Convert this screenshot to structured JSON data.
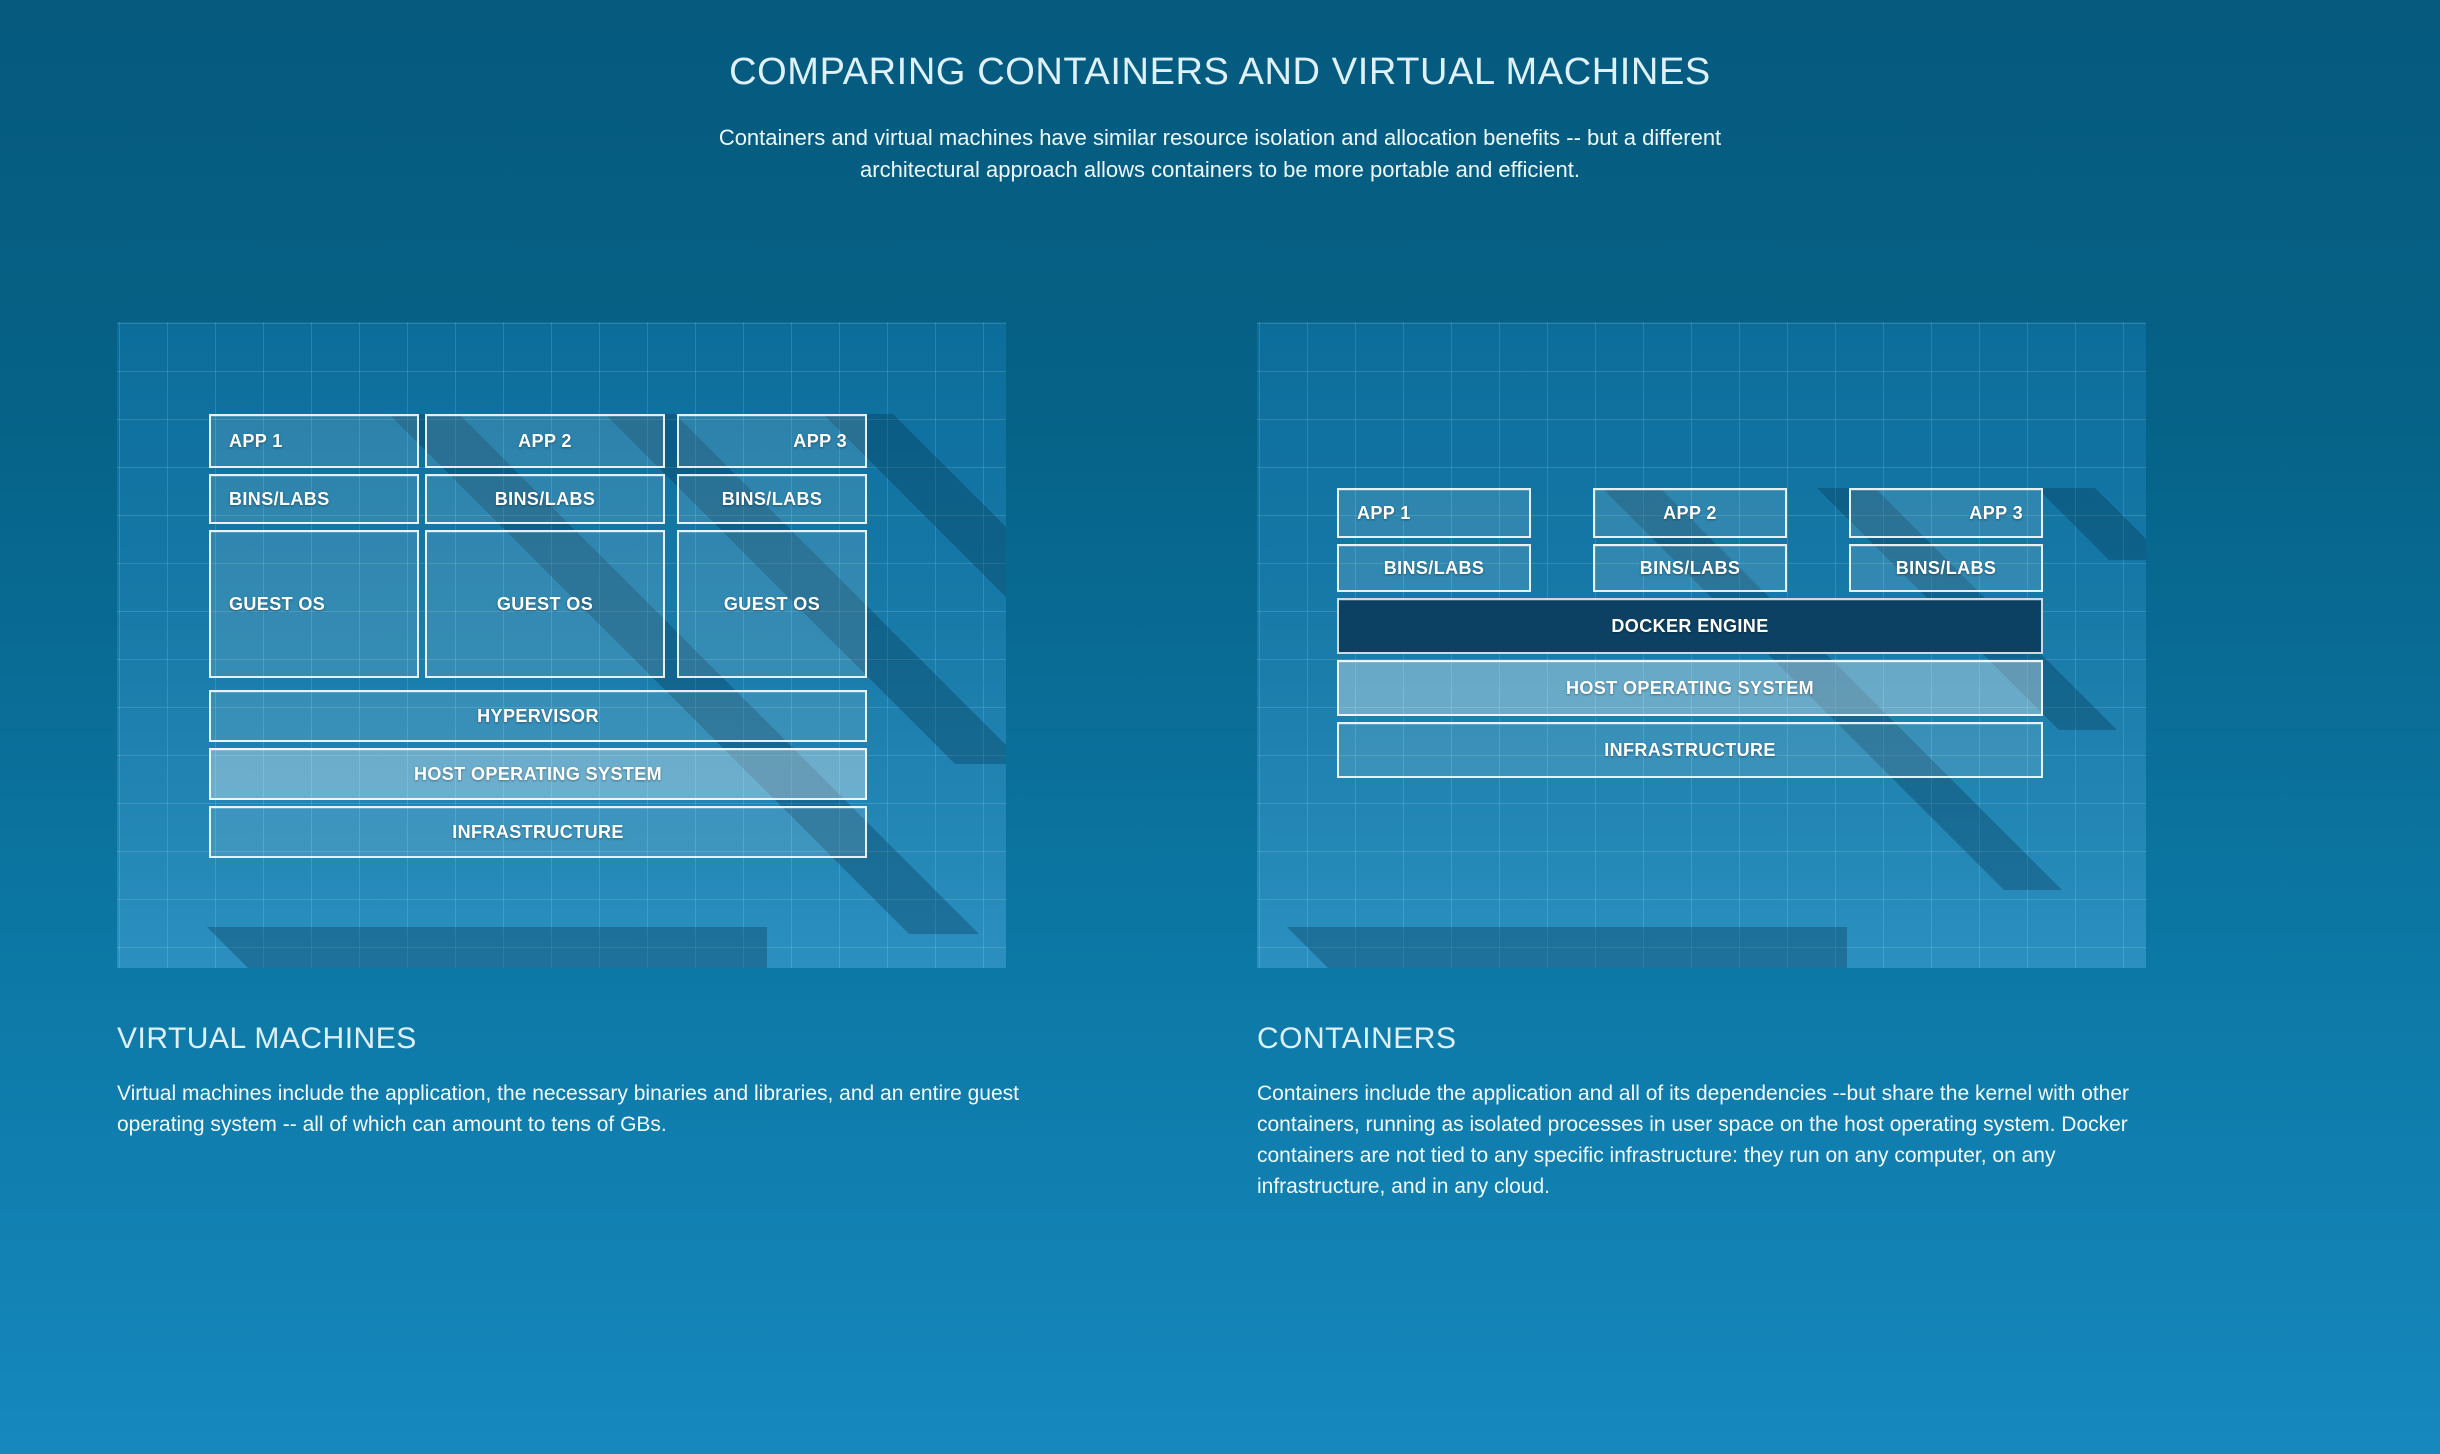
{
  "header": {
    "title": "COMPARING CONTAINERS AND VIRTUAL MACHINES",
    "subtitle_line1": "Containers and virtual machines have similar resource isolation and allocation benefits -- but a different",
    "subtitle_line2": "architectural approach allows containers to be more portable and efficient."
  },
  "colors": {
    "page_bg_top": "#055a7e",
    "page_bg_bottom": "#1688bd",
    "panel_bg_top": "#0c6d9b",
    "panel_bg_bottom": "#1b87bb",
    "box_border": "#ffffff",
    "box_fill": "rgba(255,255,255,0.12)",
    "box_fill_light": "rgba(255,255,255,0.34)",
    "docker_engine_fill": "#0d4163",
    "shadow": "rgba(3,48,74,0.30)",
    "heading_text": "#ddf0f8",
    "body_text": "#f2fafd"
  },
  "left_diagram": {
    "apps": [
      {
        "app": "APP 1",
        "bins": "BINS/LABS",
        "guest": "GUEST OS"
      },
      {
        "app": "APP 2",
        "bins": "BINS/LABS",
        "guest": "GUEST OS"
      },
      {
        "app": "APP 3",
        "bins": "BINS/LABS",
        "guest": "GUEST OS"
      }
    ],
    "layers": [
      {
        "label": "HYPERVISOR",
        "style": "normal"
      },
      {
        "label": "HOST OPERATING SYSTEM",
        "style": "light"
      },
      {
        "label": "INFRASTRUCTURE",
        "style": "normal"
      }
    ]
  },
  "right_diagram": {
    "apps": [
      {
        "app": "APP 1",
        "bins": "BINS/LABS"
      },
      {
        "app": "APP 2",
        "bins": "BINS/LABS"
      },
      {
        "app": "APP 3",
        "bins": "BINS/LABS"
      }
    ],
    "layers": [
      {
        "label": "DOCKER ENGINE",
        "style": "dark"
      },
      {
        "label": "HOST OPERATING SYSTEM",
        "style": "light"
      },
      {
        "label": "INFRASTRUCTURE",
        "style": "normal"
      }
    ]
  },
  "captions": {
    "left": {
      "title": "VIRTUAL MACHINES",
      "body": "Virtual machines include the application, the necessary binaries and libraries, and an entire guest operating system -- all of which can amount to tens of GBs."
    },
    "right": {
      "title": "CONTAINERS",
      "body": "Containers include the application and all of its dependencies --but share the kernel with other containers, running as isolated processes in user space on the host operating system. Docker containers are not tied to any specific infrastructure: they run on any computer, on any infrastructure, and in any cloud."
    }
  }
}
